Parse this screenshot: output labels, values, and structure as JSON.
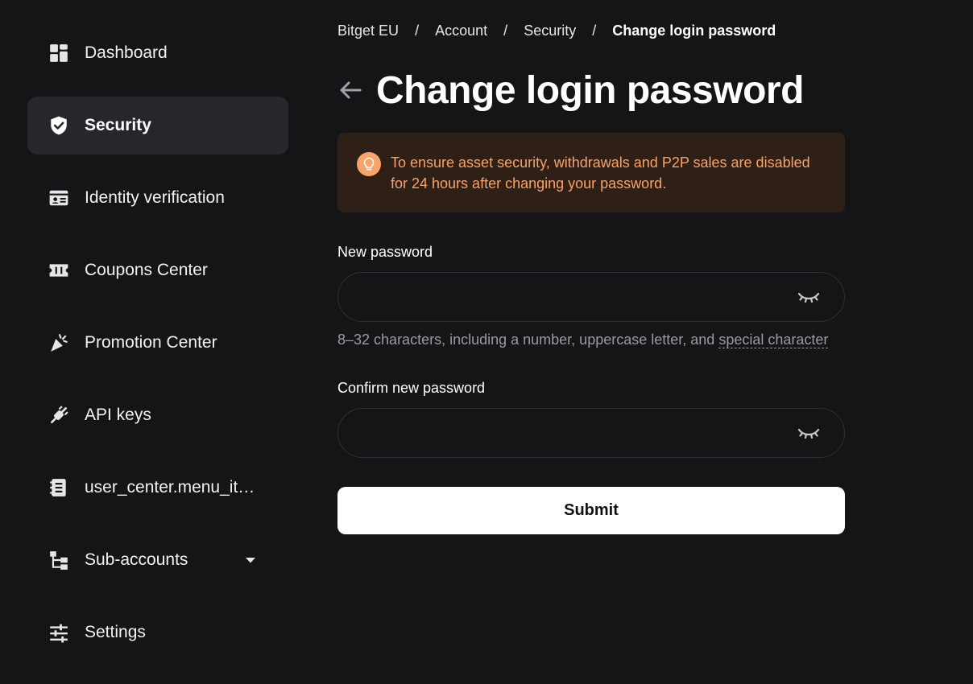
{
  "sidebar": {
    "items": [
      {
        "label": "Dashboard",
        "icon": "dashboard-grid-icon"
      },
      {
        "label": "Security",
        "icon": "shield-check-icon",
        "active": true
      },
      {
        "label": "Identity verification",
        "icon": "id-card-icon"
      },
      {
        "label": "Coupons Center",
        "icon": "ticket-icon"
      },
      {
        "label": "Promotion Center",
        "icon": "party-popper-icon"
      },
      {
        "label": "API keys",
        "icon": "plug-icon"
      },
      {
        "label": "user_center.menu_ite…",
        "icon": "document-list-icon"
      },
      {
        "label": "Sub-accounts",
        "icon": "hierarchy-icon",
        "expandable": true
      },
      {
        "label": "Settings",
        "icon": "sliders-icon"
      }
    ]
  },
  "breadcrumb": {
    "items": [
      "Bitget EU",
      "Account",
      "Security"
    ],
    "current": "Change login password",
    "separator": "/"
  },
  "page": {
    "title": "Change login password"
  },
  "notice": {
    "text": "To ensure asset security, withdrawals and P2P sales are disabled for 24 hours after changing your password.",
    "color": "#f7a36a",
    "background": "#2e1f17",
    "icon": "lightbulb-icon"
  },
  "form": {
    "new_password": {
      "label": "New password",
      "value": "",
      "placeholder": ""
    },
    "hint_prefix": "8–32 characters, including a number, uppercase letter, and ",
    "hint_link": "special character",
    "confirm_password": {
      "label": "Confirm new password",
      "value": "",
      "placeholder": ""
    },
    "submit_label": "Submit"
  },
  "colors": {
    "background": "#151517",
    "sidebar_active": "#26262b",
    "accent_warning": "#f7a36a"
  }
}
